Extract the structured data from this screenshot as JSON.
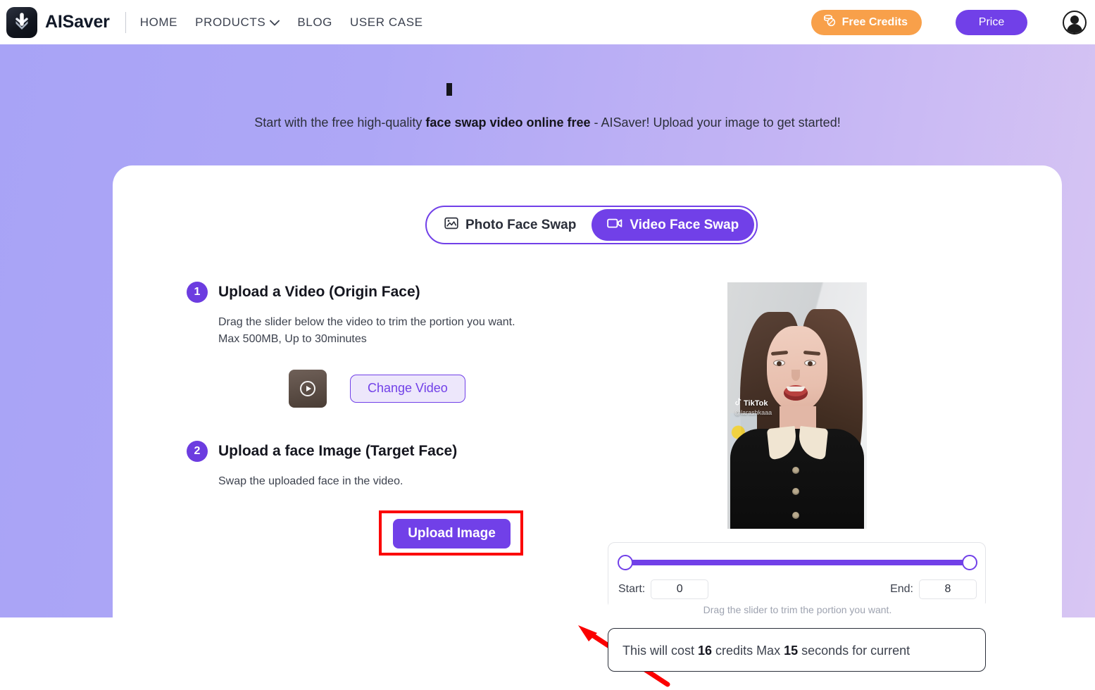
{
  "header": {
    "brand_name": "AISaver",
    "logo_icon": "download-arrow-logo",
    "nav": [
      {
        "label": "HOME",
        "has_chevron": false
      },
      {
        "label": "PRODUCTS",
        "has_chevron": true,
        "chevron": "⌄"
      },
      {
        "label": "BLOG",
        "has_chevron": false
      },
      {
        "label": "USER CASE",
        "has_chevron": false
      }
    ],
    "free_credits_label": "Free Credits",
    "free_credits_icon": "coins-icon",
    "free_credits_color": "#f8a04a",
    "price_label": "Price",
    "price_color": "#7140e8",
    "avatar_icon": "user-avatar-icon"
  },
  "hero": {
    "subtitle_prefix": "Start with the free high-quality ",
    "subtitle_bold": "face swap video online free",
    "subtitle_suffix": " - AISaver! Upload your image to get started!",
    "background_from": "#a8a3f6",
    "background_to": "#d8c6f3"
  },
  "tabs": [
    {
      "label": "Photo Face Swap",
      "icon": "image-icon",
      "active": false
    },
    {
      "label": "Video Face Swap",
      "icon": "video-camera-icon",
      "active": true
    }
  ],
  "steps": [
    {
      "number": "1",
      "title": "Upload a Video (Origin Face)",
      "desc_line1": "Drag the slider below the video to trim the portion you want.",
      "desc_line2": "Max 500MB, Up to 30minutes",
      "change_video_label": "Change Video",
      "thumbnail_icon": "video-thumbnail-play-icon"
    },
    {
      "number": "2",
      "title": "Upload a face Image (Target Face)",
      "desc_line1": "Swap the uploaded face in the video.",
      "upload_label": "Upload Image"
    }
  ],
  "annotation": {
    "highlight_color": "#fb0000",
    "arrow_icon": "red-arrow-pointing-left-up"
  },
  "preview": {
    "watermark": "TikTok",
    "watermark_icon": "tiktok-note-icon",
    "handle": "@larashkaaa"
  },
  "trim": {
    "start_label": "Start:",
    "start_value": "0",
    "end_label": "End:",
    "end_value": "8",
    "hint": "Drag the slider to trim the portion you want.",
    "track_color": "#7140e8"
  },
  "cost": {
    "prefix": "This will cost ",
    "credits": "16",
    "middle": " credits Max ",
    "seconds": "15",
    "suffix": " seconds for current"
  }
}
